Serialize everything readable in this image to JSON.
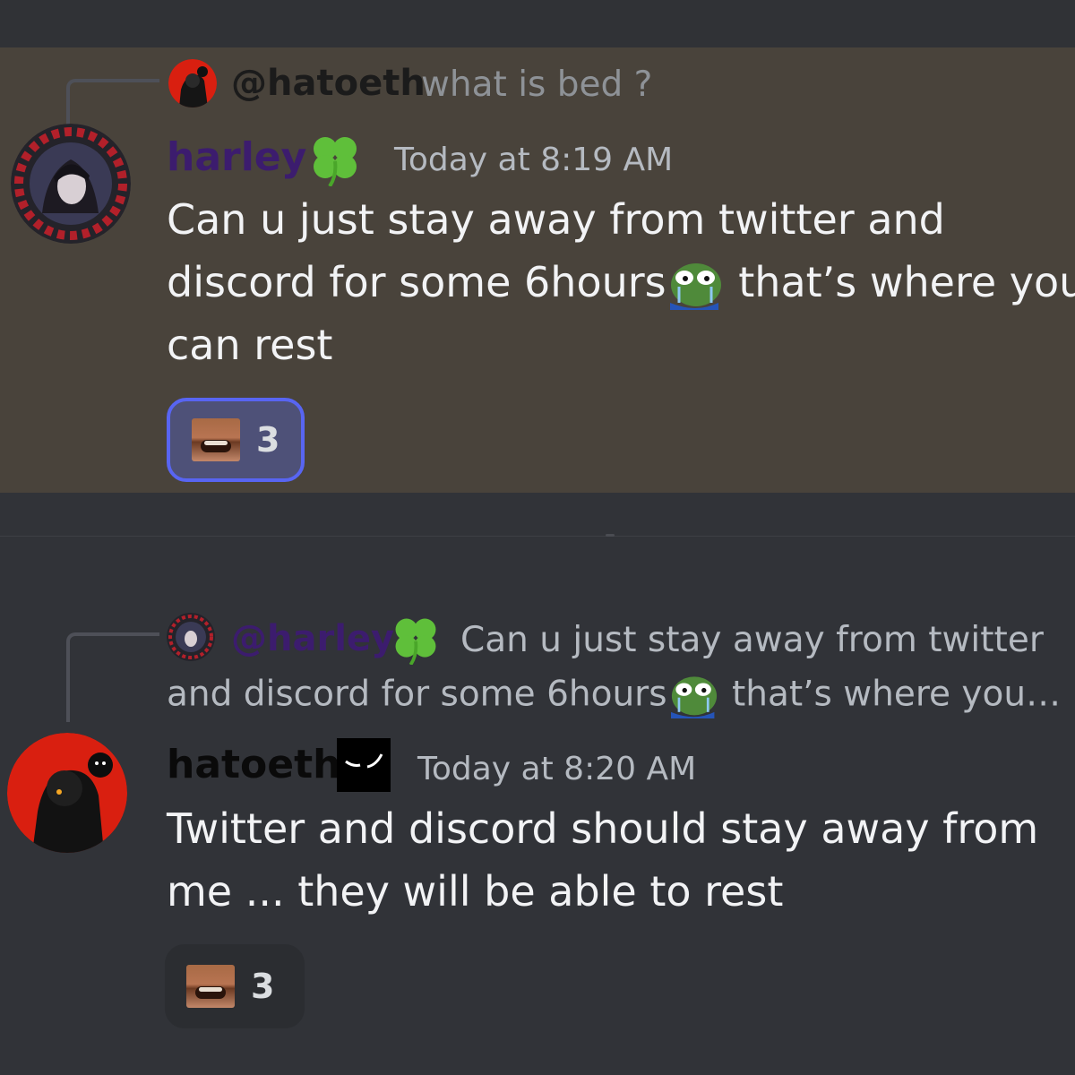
{
  "messages": [
    {
      "reply": {
        "author": "@hatoeth",
        "text": "what is bed ?"
      },
      "author": "harley",
      "author_color": "#3c1c6e",
      "author_badge": "clover-icon",
      "timestamp": "Today at 8:19 AM",
      "body": {
        "line1": "Can u just stay away from twitter and",
        "line2a": "discord for some 6hours",
        "line2b": "that’s where you",
        "line3": "can rest"
      },
      "reaction": {
        "emoji": "laughing-face-emoji",
        "count": "3",
        "selected": true
      }
    },
    {
      "reply": {
        "author": "@harley",
        "text_line1": "Can u just stay away from twitter",
        "text_line2a": "and discord for some 6hours",
        "text_line2b": "that’s where you…"
      },
      "author": "hatoeth",
      "author_color": "#0a0a0a",
      "author_badge": "evil-eyes-icon",
      "timestamp": "Today at 8:20 AM",
      "body": {
        "line1": "Twitter and discord should stay away from",
        "line2": "me ... they will be able to rest"
      },
      "reaction": {
        "emoji": "laughing-face-emoji",
        "count": "3",
        "selected": false
      }
    }
  ],
  "colors": {
    "highlight_background": "#49433b",
    "background": "#313338",
    "reaction_selected_border": "#5865f2",
    "reaction_selected_background": "#4e5178"
  }
}
